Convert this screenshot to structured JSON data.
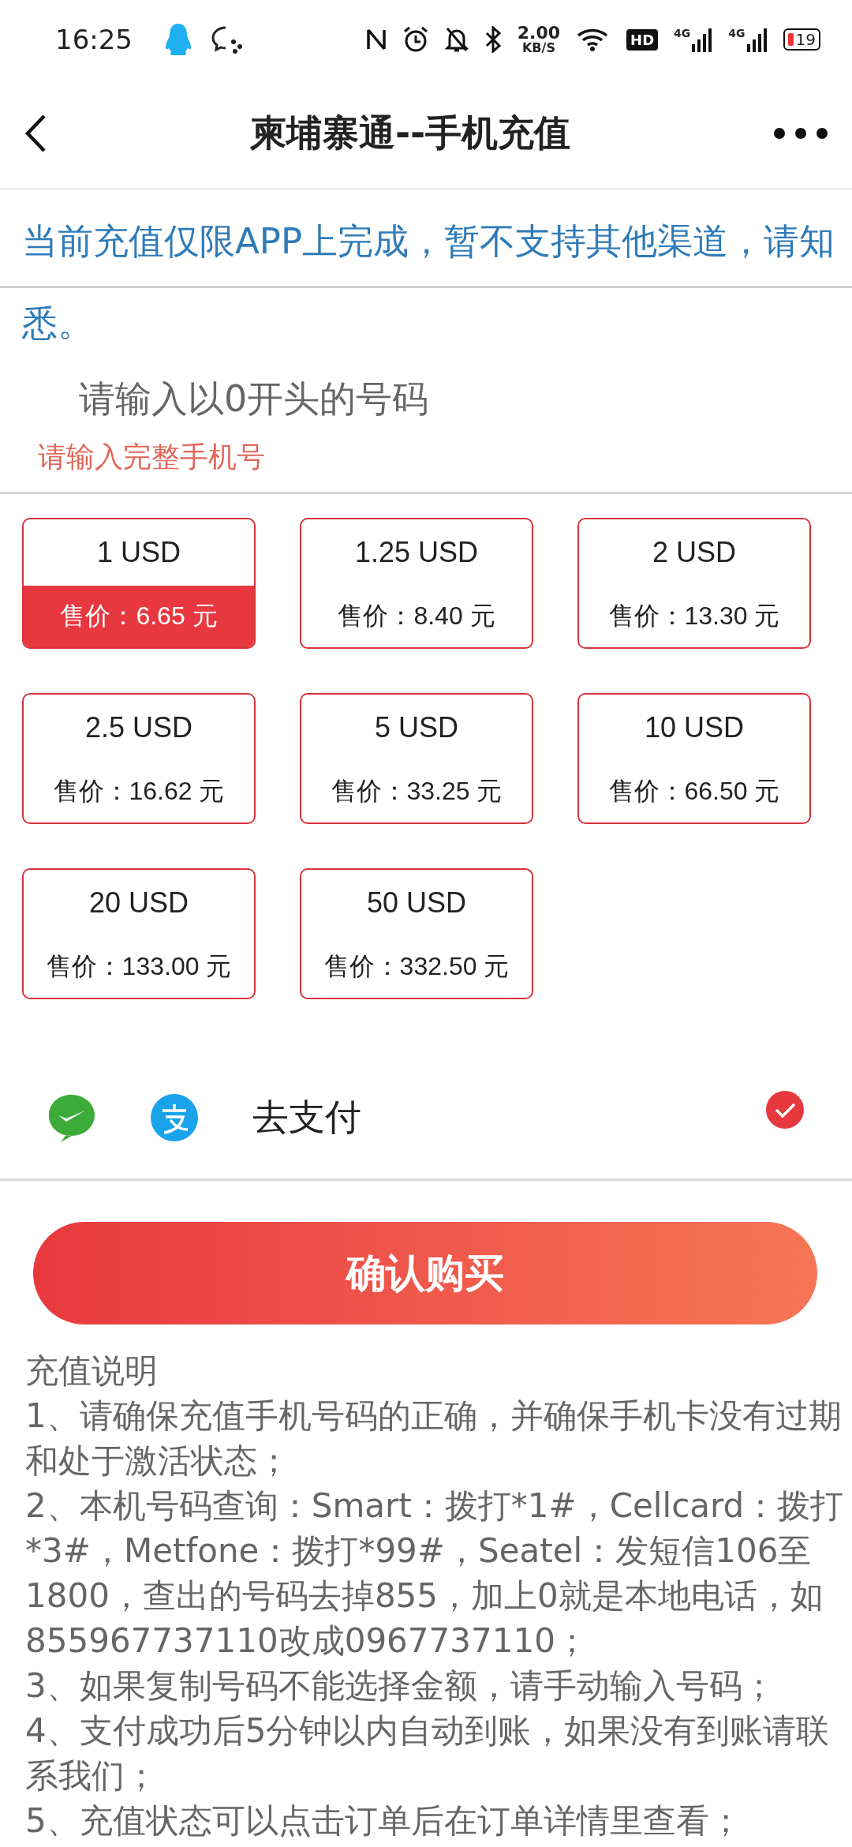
{
  "status_bar": {
    "time": "16:25",
    "net_speed": "2.00",
    "net_unit": "KB/S",
    "hd_badge": "HD",
    "signal_labels": [
      "4G",
      "4G"
    ],
    "battery": "19"
  },
  "header": {
    "title": "柬埔寨通--手机充值"
  },
  "notice": "当前充值仅限APP上完成，暂不支持其他渠道，请知悉。",
  "phone_input": {
    "placeholder": "请输入以0开头的号码",
    "error": "请输入完整手机号"
  },
  "packages": [
    {
      "amount": "1 USD",
      "price": "售价：6.65 元",
      "selected": true
    },
    {
      "amount": "1.25 USD",
      "price": "售价：8.40 元",
      "selected": false
    },
    {
      "amount": "2 USD",
      "price": "售价：13.30 元",
      "selected": false
    },
    {
      "amount": "2.5 USD",
      "price": "售价：16.62 元",
      "selected": false
    },
    {
      "amount": "5 USD",
      "price": "售价：33.25 元",
      "selected": false
    },
    {
      "amount": "10 USD",
      "price": "售价：66.50 元",
      "selected": false
    },
    {
      "amount": "20 USD",
      "price": "售价：133.00 元",
      "selected": false
    },
    {
      "amount": "50 USD",
      "price": "售价：332.50 元",
      "selected": false
    }
  ],
  "payment": {
    "label": "去支付",
    "selected": true
  },
  "confirm_button": "确认购买",
  "instructions": {
    "title": "充值说明",
    "items": [
      "1、请确保充值手机号码的正确，并确保手机卡没有过期和处于激活状态；",
      "2、本机号码查询：Smart：拨打*1#，Cellcard：拨打*3#，Metfone：拨打*99#，Seatel：发短信106至1800，查出的号码去掉855，加上0就是本地电话，如855967737110改成0967737110；",
      "3、如果复制号码不能选择金额，请手动输入号码；",
      "4、支付成功后5分钟以内自动到账，如果没有到账请联系我们；",
      "5、充值状态可以点击订单后在订单详情里查看；"
    ]
  }
}
